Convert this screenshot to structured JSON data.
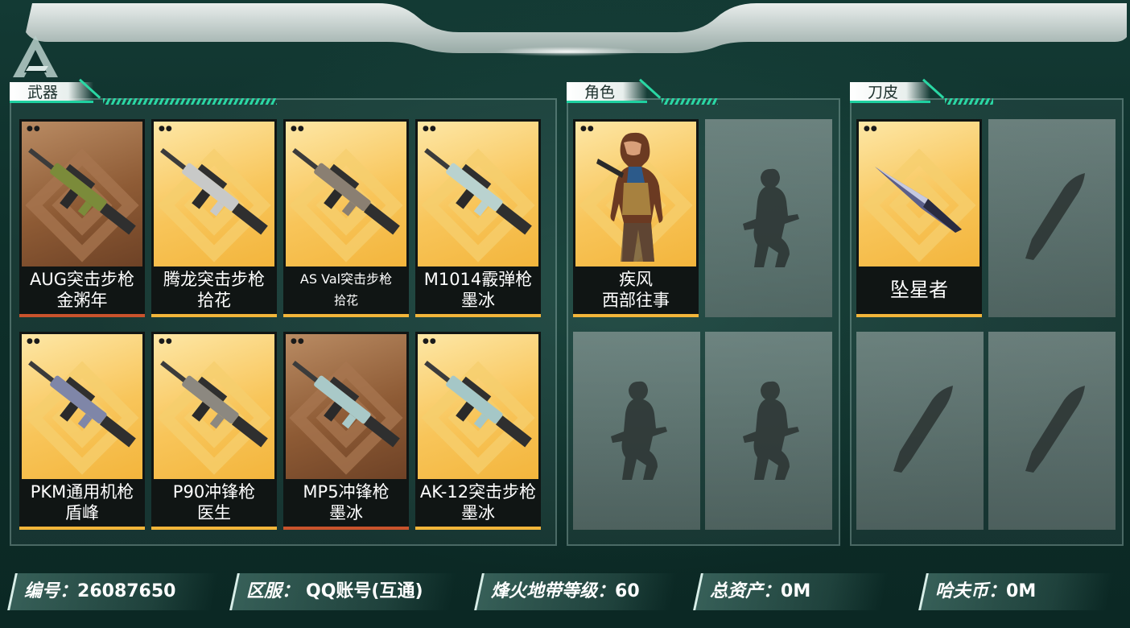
{
  "sections": {
    "weapons": "武器",
    "characters": "角色",
    "knives": "刀皮"
  },
  "weapons": [
    {
      "name": "AUG突击步枪",
      "skin": "金粥年",
      "rarity": "red"
    },
    {
      "name": "腾龙突击步枪",
      "skin": "拾花",
      "rarity": "gold"
    },
    {
      "name": "AS Val突击步枪",
      "skin": "拾花",
      "rarity": "gold"
    },
    {
      "name": "M1014霰弹枪",
      "skin": "墨冰",
      "rarity": "gold"
    },
    {
      "name": "PKM通用机枪",
      "skin": "盾峰",
      "rarity": "gold"
    },
    {
      "name": "P90冲锋枪",
      "skin": "医生",
      "rarity": "gold"
    },
    {
      "name": "MP5冲锋枪",
      "skin": "墨冰",
      "rarity": "red"
    },
    {
      "name": "AK-12突击步枪",
      "skin": "墨冰",
      "rarity": "gold"
    }
  ],
  "characters": [
    {
      "name": "疾风",
      "skin": "西部往事",
      "rarity": "gold"
    }
  ],
  "knives": [
    {
      "name": "坠星者",
      "rarity": "gold"
    }
  ],
  "info": {
    "id_label": "编号：",
    "id_value": "26087650",
    "server_label": "区服：",
    "server_value": "QQ账号(互通)",
    "level_label": "烽火地带等级：",
    "level_value": "60",
    "assets_label": "总资产：",
    "assets_value": "0M",
    "coin_label": "哈夫币：",
    "coin_value": "0M"
  },
  "colors": {
    "accent": "#2ad7a4",
    "gold": "#f2b53a",
    "red": "#c9532c"
  }
}
